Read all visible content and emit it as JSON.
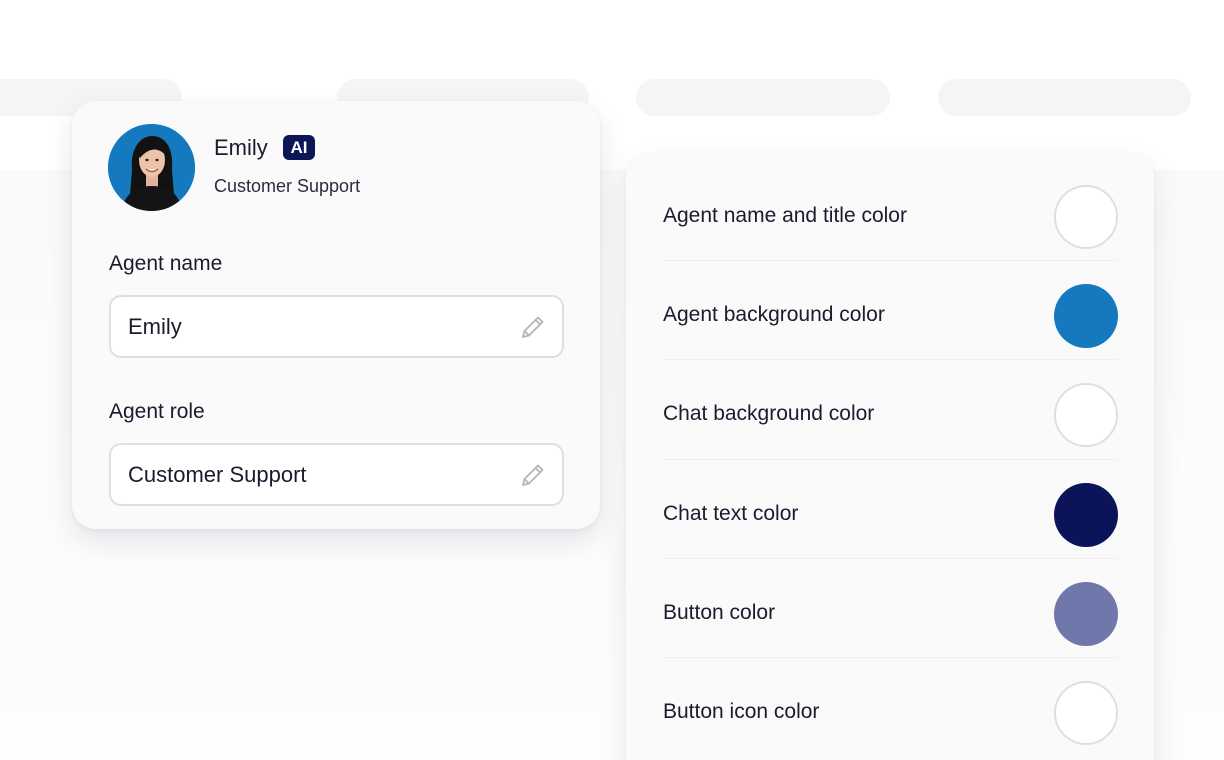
{
  "profile": {
    "name": "Emily",
    "badge": "AI",
    "role": "Customer Support"
  },
  "form": {
    "name_label": "Agent name",
    "name_value": "Emily",
    "role_label": "Agent role",
    "role_value": "Customer Support"
  },
  "colors": {
    "items": [
      {
        "label": "Agent name and title color",
        "color": "#ffffff"
      },
      {
        "label": "Agent background color",
        "color": "#1479bf"
      },
      {
        "label": "Chat background color",
        "color": "#ffffff"
      },
      {
        "label": "Chat text color",
        "color": "#0b1458"
      },
      {
        "label": "Button color",
        "color": "#6f77ab"
      },
      {
        "label": "Button icon color",
        "color": "#ffffff"
      }
    ]
  }
}
